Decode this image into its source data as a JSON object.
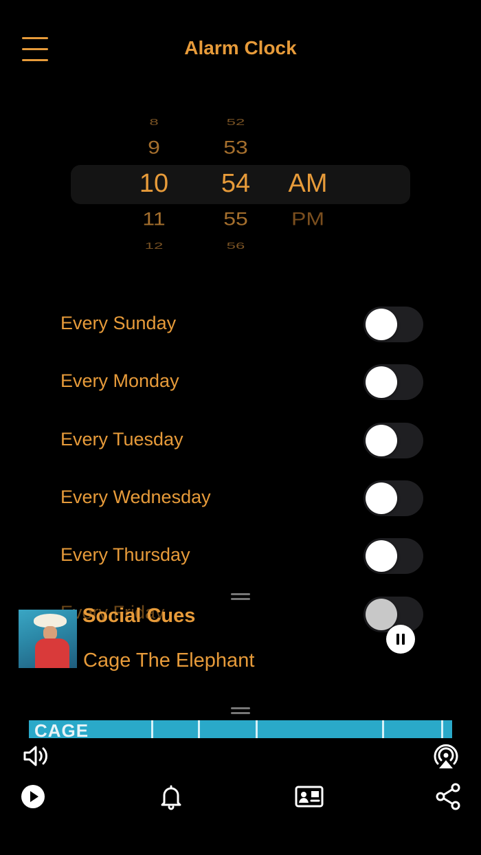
{
  "header": {
    "title": "Alarm Clock",
    "menu_icon": "hamburger-menu-icon"
  },
  "picker": {
    "hours": [
      "8",
      "9",
      "10",
      "11",
      "12"
    ],
    "minutes": [
      "52",
      "53",
      "54",
      "55",
      "56"
    ],
    "period": [
      "AM",
      "PM"
    ],
    "selected": {
      "hour": "10",
      "minute": "54",
      "period": "AM"
    }
  },
  "days": [
    {
      "label": "Every Sunday",
      "enabled": false
    },
    {
      "label": "Every Monday",
      "enabled": false
    },
    {
      "label": "Every Tuesday",
      "enabled": false
    },
    {
      "label": "Every Wednesday",
      "enabled": false
    },
    {
      "label": "Every Thursday",
      "enabled": false
    },
    {
      "label": "Every Friday",
      "enabled": false
    }
  ],
  "now_playing": {
    "song": "Social Cues",
    "artist": "Cage The Elephant",
    "album_strip_text": "CAGE",
    "state": "playing"
  },
  "bottom_bar": {
    "icons": [
      "volume-icon",
      "airplay-icon",
      "play-icon",
      "bell-icon",
      "contact-card-icon",
      "share-icon"
    ]
  },
  "colors": {
    "accent": "#e79b3a",
    "background": "#000000",
    "toggle_track": "#1f1f22"
  }
}
